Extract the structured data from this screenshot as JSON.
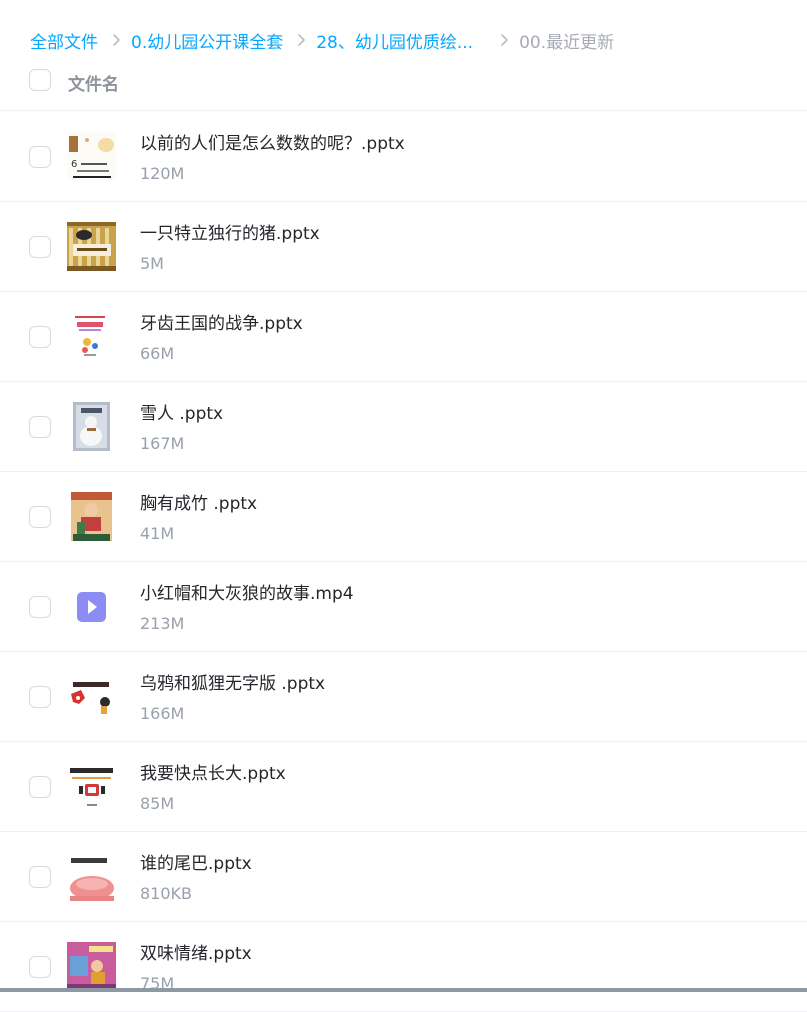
{
  "breadcrumb": {
    "items": [
      "全部文件",
      "0.幼儿园公开课全套",
      "28、幼儿园优质绘..."
    ],
    "current": "00.最近更新"
  },
  "table": {
    "header": "文件名"
  },
  "files": [
    {
      "name": "以前的人们是怎么数数的呢？.pptx",
      "size": "120M",
      "icon": "pptx-thumbnail"
    },
    {
      "name": "一只特立独行的猪.pptx",
      "size": "5M",
      "icon": "pptx-thumbnail"
    },
    {
      "name": "牙齿王国的战争.pptx",
      "size": "66M",
      "icon": "pptx-thumbnail"
    },
    {
      "name": "雪人 .pptx",
      "size": "167M",
      "icon": "pptx-thumbnail"
    },
    {
      "name": "胸有成竹 .pptx",
      "size": "41M",
      "icon": "pptx-thumbnail"
    },
    {
      "name": "小红帽和大灰狼的故事.mp4",
      "size": "213M",
      "icon": "video-file-icon"
    },
    {
      "name": "乌鸦和狐狸无字版 .pptx",
      "size": "166M",
      "icon": "pptx-thumbnail"
    },
    {
      "name": "我要快点长大.pptx",
      "size": "85M",
      "icon": "pptx-thumbnail"
    },
    {
      "name": "谁的尾巴.pptx",
      "size": "810KB",
      "icon": "pptx-thumbnail"
    },
    {
      "name": "双味情绪.pptx",
      "size": "75M",
      "icon": "pptx-thumbnail"
    }
  ],
  "colors": {
    "link": "#06a7ff",
    "current_crumb": "#a7abb5",
    "file_name": "#25262b",
    "file_size": "#9aa0ab",
    "video_icon": "#8d8cf5"
  }
}
